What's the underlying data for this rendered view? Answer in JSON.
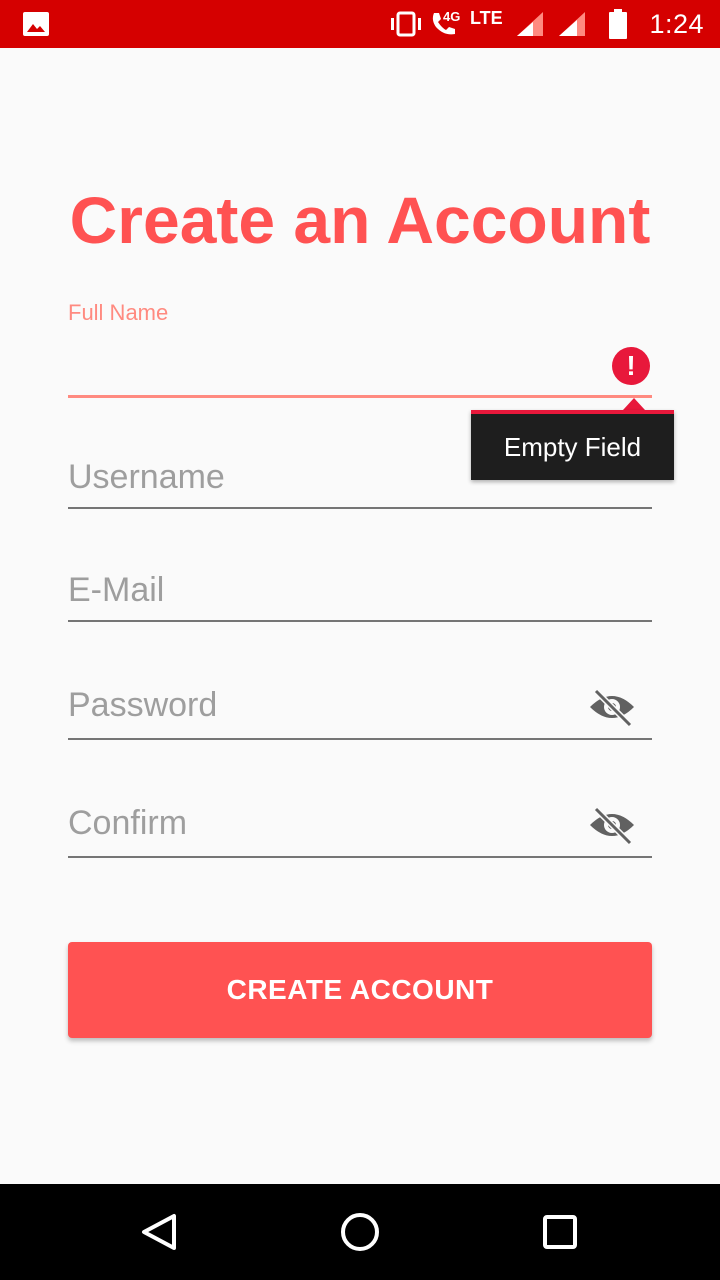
{
  "status_bar": {
    "time": "1:24",
    "network_4g": "4G",
    "network_lte": "LTE",
    "icons": [
      "gallery-icon",
      "vibrate-icon",
      "wifi-calling-icon",
      "signal-icon",
      "signal-icon",
      "battery-icon"
    ]
  },
  "title": "Create an Account",
  "fields": {
    "full_name": {
      "label": "Full Name",
      "value": "",
      "error": "Empty Field"
    },
    "username": {
      "placeholder": "Username"
    },
    "email": {
      "placeholder": "E-Mail"
    },
    "password": {
      "placeholder": "Password"
    },
    "confirm": {
      "placeholder": "Confirm"
    }
  },
  "button": {
    "label": "CREATE ACCOUNT"
  },
  "colors": {
    "status_bar": "#d50000",
    "accent": "#ff5252",
    "error": "#e8183b",
    "label": "#ff8a80"
  },
  "nav": [
    "back-icon",
    "home-icon",
    "recents-icon"
  ]
}
